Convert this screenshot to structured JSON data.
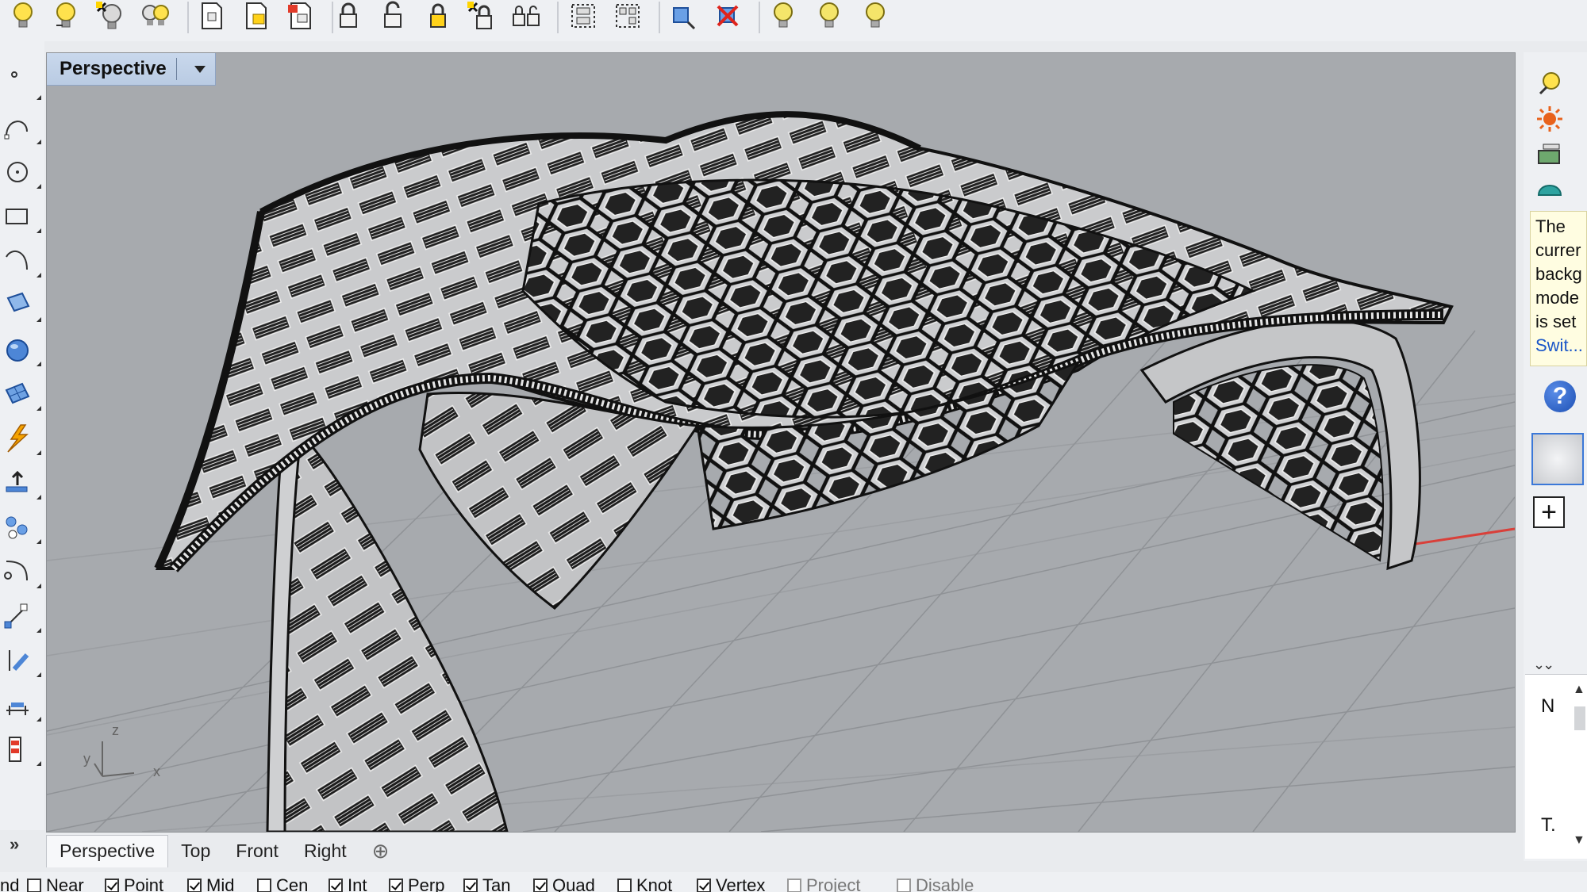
{
  "top_toolbar": {
    "icons": [
      "lightbulb-on-icon",
      "lightbulb-on-icon",
      "lightbulb-selection-icon",
      "lightbulb-swap-icon",
      "document-lock-icon",
      "document-lock-gold-icon",
      "document-lock-red-icon",
      "padlock-icon",
      "padlock-open-icon",
      "padlock-gold-icon",
      "padlock-selection-icon",
      "padlock-swap-icon",
      "group-icon",
      "ungroup-icon",
      "block-insert-icon",
      "block-delete-icon",
      "lightbulb-off-icon",
      "lightbulb-off-icon",
      "lightbulb-off-icon"
    ]
  },
  "left_toolbar": {
    "icons": [
      "point-icon",
      "curve-icon",
      "circle-icon",
      "rectangle-icon",
      "arc-icon",
      "surface-icon",
      "sphere-icon",
      "mesh-icon",
      "explode-icon",
      "extrude-icon",
      "transform-icon",
      "fillet-icon",
      "scale-icon",
      "drafting-icon",
      "dimension-icon",
      "layout-icon"
    ],
    "more_label": "»"
  },
  "viewport": {
    "title": "Perspective",
    "axis_labels": {
      "x": "x",
      "y": "y",
      "z": "z"
    }
  },
  "viewport_tabs": {
    "tabs": [
      "Perspective",
      "Top",
      "Front",
      "Right"
    ],
    "active": "Perspective",
    "add_label": "⊕"
  },
  "osnap": {
    "lead": "nd",
    "items": [
      {
        "label": "Near",
        "checked": false
      },
      {
        "label": "Point",
        "checked": true
      },
      {
        "label": "Mid",
        "checked": true
      },
      {
        "label": "Cen",
        "checked": false
      },
      {
        "label": "Int",
        "checked": true
      },
      {
        "label": "Perp",
        "checked": true
      },
      {
        "label": "Tan",
        "checked": true
      },
      {
        "label": "Quad",
        "checked": true
      },
      {
        "label": "Knot",
        "checked": false
      },
      {
        "label": "Vertex",
        "checked": true
      },
      {
        "label": "Project",
        "checked": false
      },
      {
        "label": "Disable",
        "checked": false
      }
    ]
  },
  "right_panel": {
    "icons": [
      "light-icon",
      "sun-icon",
      "layer-icon",
      "environment-icon"
    ],
    "message_lines": [
      "The",
      "currer",
      "backg",
      "mode",
      "is set"
    ],
    "message_link": "Swit...",
    "help_label": "?",
    "add_label": "+",
    "chevrons": "⌄⌄",
    "lower_label_n": "N",
    "lower_label_t": "T.",
    "scroll_up": "▲",
    "scroll_down": "▼"
  },
  "colors": {
    "viewport_background": "#a7aaae",
    "grid": "#8f9296",
    "model_fill": "#c8c9cb",
    "model_edge": "#1a1a1a",
    "x_axis": "#d9403a",
    "title_tab": "#bcd0e8"
  }
}
